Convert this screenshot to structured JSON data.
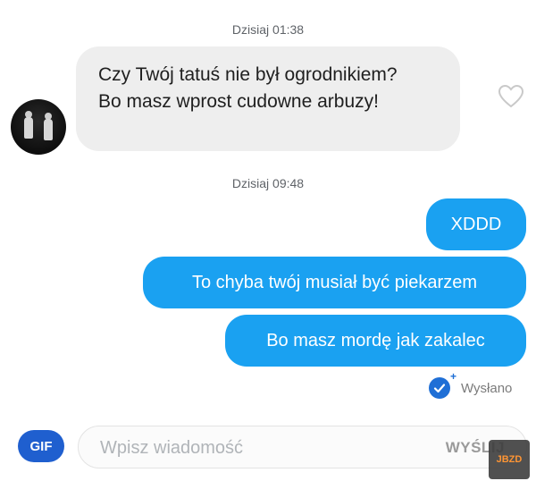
{
  "conversation": {
    "timestamp_1": "Dzisiaj 01:38",
    "incoming_message_line_1": "Czy Twój tatuś nie był ogrodnikiem?",
    "incoming_message_line_2": "Bo masz wprost cudowne arbuzy!",
    "timestamp_2": "Dzisiaj 09:48",
    "outgoing_messages": [
      "XDDD",
      "To chyba twój musiał być piekarzem",
      "Bo masz mordę jak zakalec"
    ],
    "status": "Wysłano"
  },
  "composer": {
    "gif_label": "GIF",
    "placeholder": "Wpisz wiadomość",
    "send_label": "WYŚLIJ"
  },
  "watermark": "JBZD",
  "colors": {
    "outgoing_bubble": "#1aa1f1",
    "incoming_bubble": "#eeeeee",
    "gif_button": "#1f5fcf",
    "status_icon": "#1f6fd6"
  },
  "icons": {
    "like": "heart-icon",
    "sent_status": "check-circle-icon"
  }
}
